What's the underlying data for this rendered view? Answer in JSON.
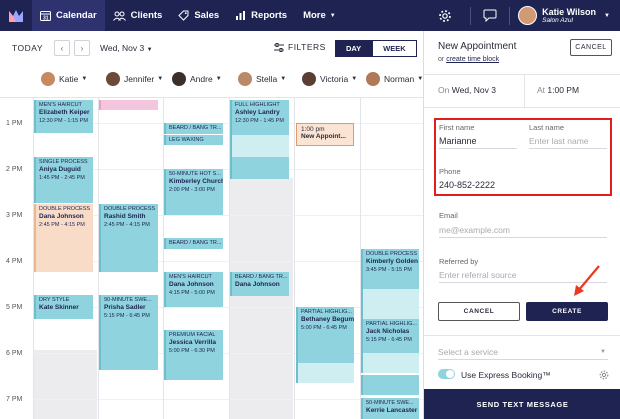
{
  "nav": {
    "items": [
      {
        "label": "Calendar",
        "icon": "calendar-icon",
        "active": true
      },
      {
        "label": "Clients",
        "icon": "clients-icon",
        "active": false
      },
      {
        "label": "Sales",
        "icon": "tag-icon",
        "active": false
      },
      {
        "label": "Reports",
        "icon": "reports-icon",
        "active": false
      },
      {
        "label": "More",
        "icon": "caret-down-icon",
        "active": false
      }
    ],
    "user_name": "Katie Wilson",
    "salon": "Salon Azul",
    "brand_color": "#1f2352"
  },
  "toolbar": {
    "today": "TODAY",
    "date": "Wed, Nov 3",
    "filters": "FILTERS",
    "day": "DAY",
    "week": "WEEK"
  },
  "staff": [
    "Katie",
    "Jennifer",
    "Andre",
    "Stella",
    "Victoria",
    "Norman"
  ],
  "times": [
    "1 PM",
    "2 PM",
    "3 PM",
    "4 PM",
    "5 PM",
    "6 PM",
    "7 PM"
  ],
  "appointments": {
    "a1": {
      "service": "MEN'S HAIRCUT",
      "client": "Elizabeth Keiper",
      "time": "12:30 PM - 1:15 PM"
    },
    "a2": {
      "service": "SINGLE PROCESS",
      "client": "Aniya Duguid",
      "time": "1:45 PM - 2:45 PM"
    },
    "a3": {
      "service": "DOUBLE PROCESS",
      "client": "Dana Johnson",
      "time": "2:45 PM - 4:15 PM"
    },
    "a4": {
      "service": "DRY STYLE",
      "client": "Kate Skinner"
    },
    "a5": {
      "service": "DOUBLE PROCESS",
      "client": "Rashid Smith",
      "time": "2:45 PM - 4:15 PM"
    },
    "a6": {
      "service": "90-MINUTE SWE...",
      "client": "Prisha Sadler",
      "time": "5:15 PM - 6:45 PM"
    },
    "a7": {
      "service": "BEARD / BANG TR..."
    },
    "a8": {
      "service": "LEG WAXING"
    },
    "a9": {
      "service": "50-MINUTE HOT S...",
      "client": "Kimberley Churchi",
      "time": "2:00 PM - 3:00 PM"
    },
    "a10": {
      "service": "BEARD / BANG TR..."
    },
    "a11": {
      "service": "MEN'S HAIRCUT",
      "client": "Dana Johnson",
      "time": "4:15 PM - 5:00 PM"
    },
    "a12": {
      "service": "PREMIUM FACIAL",
      "client": "Jessica Verrilla",
      "time": "5:00 PM - 6:30 PM"
    },
    "a13": {
      "service": "FULL HIGHLIGHT",
      "client": "Ashley Landry",
      "time": "12:30 PM - 1:45 PM"
    },
    "a14": {
      "service": "BEARD / BANG TR...",
      "client": "Dana Johnson"
    },
    "a15": {
      "service": "PARTIAL HIGHLIG...",
      "client": "Bethaney Begum",
      "time": "5:00 PM - 6:45 PM"
    },
    "a16": {
      "service": "DOUBLE PROCESS",
      "client": "Kimberly Golden",
      "time": "3:45 PM - 5:15 PM"
    },
    "a17": {
      "service": "PARTIAL HIGHLIG...",
      "client": "Jack Nicholas",
      "time": "5:15 PM - 6:45 PM"
    },
    "a18": {
      "service": "50-MINUTE SWE...",
      "client": "Kerrie Lancaster"
    },
    "new": {
      "time": "1:00 pm",
      "label": "New Appoint..."
    }
  },
  "panel": {
    "title": "New Appointment",
    "or_text": "or",
    "time_block": "create time block",
    "cancel_top": "CANCEL",
    "on_label": "On",
    "date": "Wed, Nov 3",
    "at_label": "At",
    "time": "1:00 PM",
    "first_name_label": "First name",
    "first_name": "Marianne",
    "last_name_label": "Last name",
    "last_name_placeholder": "Enter last name",
    "phone_label": "Phone",
    "phone": "240-852-2222",
    "email_label": "Email",
    "email_placeholder": "me@example.com",
    "referred_label": "Referred by",
    "referred_placeholder": "Enter referral source",
    "cancel": "CANCEL",
    "create": "CREATE",
    "service_placeholder": "Select a service",
    "express": "Use Express Booking™",
    "send_text": "SEND TEXT MESSAGE",
    "highlight_color": "#e21d1d"
  }
}
